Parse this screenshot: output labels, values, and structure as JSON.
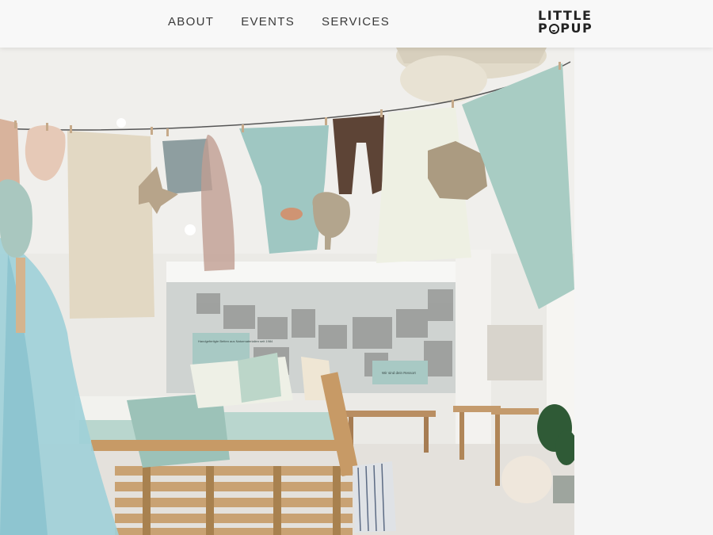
{
  "nav": {
    "items": [
      {
        "label": "ABOUT"
      },
      {
        "label": "EVENTS"
      },
      {
        "label": "SERVICES"
      }
    ]
  },
  "logo": {
    "line1": "LITTLE",
    "line2_p": "P",
    "line2_rest": "PUP"
  },
  "hero": {
    "sign_text_1": "Handgefertigte Betten aus Naturmaterialien seit 1984",
    "sign_text_2": "Wir sind dein Ressort"
  },
  "colors": {
    "header_bg": "#f8f8f8",
    "text": "#3a3a3a",
    "mint": "#9fc4bd",
    "wall": "#e9e8e3"
  }
}
